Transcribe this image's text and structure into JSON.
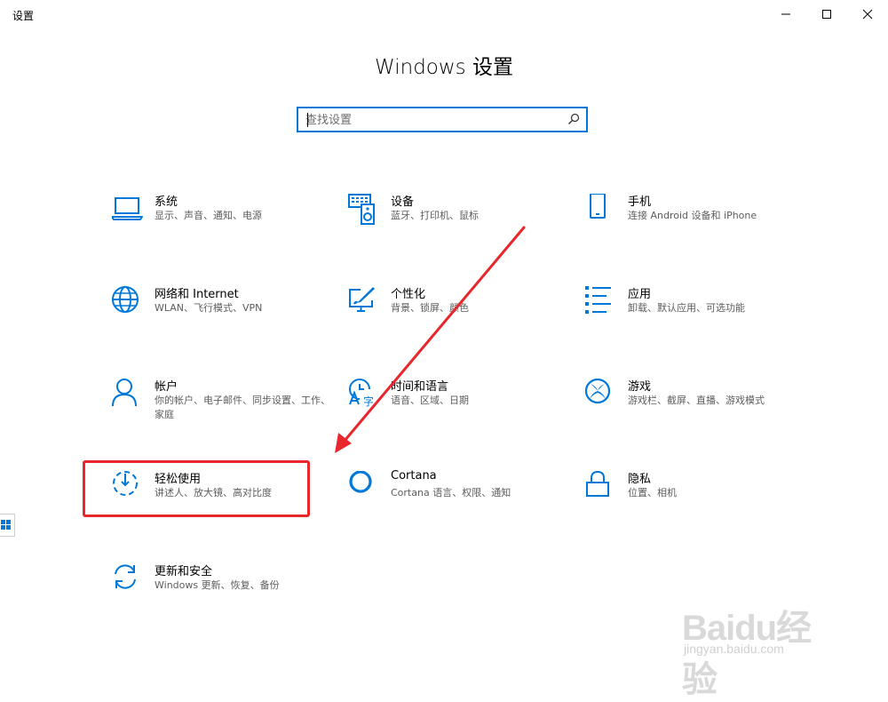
{
  "window": {
    "title": "设置"
  },
  "header": {
    "title": "Windows 设置"
  },
  "search": {
    "placeholder": "查找设置",
    "value": ""
  },
  "accent_color": "#0078d7",
  "highlight_color": "#e8262b",
  "categories": [
    {
      "id": "system",
      "title": "系统",
      "desc": "显示、声音、通知、电源",
      "icon": "laptop-icon"
    },
    {
      "id": "devices",
      "title": "设备",
      "desc": "蓝牙、打印机、鼠标",
      "icon": "keyboard-speaker-icon"
    },
    {
      "id": "phone",
      "title": "手机",
      "desc": "连接 Android 设备和 iPhone",
      "icon": "phone-icon"
    },
    {
      "id": "network",
      "title": "网络和 Internet",
      "desc": "WLAN、飞行模式、VPN",
      "icon": "globe-icon"
    },
    {
      "id": "personalization",
      "title": "个性化",
      "desc": "背景、锁屏、颜色",
      "icon": "paint-brush-icon"
    },
    {
      "id": "apps",
      "title": "应用",
      "desc": "卸载、默认应用、可选功能",
      "icon": "app-list-icon"
    },
    {
      "id": "accounts",
      "title": "帐户",
      "desc": "你的帐户、电子邮件、同步设置、工作、家庭",
      "icon": "person-icon"
    },
    {
      "id": "time-language",
      "title": "时间和语言",
      "desc": "语音、区域、日期",
      "icon": "clock-language-icon"
    },
    {
      "id": "gaming",
      "title": "游戏",
      "desc": "游戏栏、截屏、直播、游戏模式",
      "icon": "xbox-icon"
    },
    {
      "id": "ease-of-access",
      "title": "轻松使用",
      "desc": "讲述人、放大镜、高对比度",
      "icon": "ease-of-access-icon"
    },
    {
      "id": "cortana",
      "title": "Cortana",
      "desc": "Cortana 语言、权限、通知",
      "icon": "cortana-ring-icon"
    },
    {
      "id": "privacy",
      "title": "隐私",
      "desc": "位置、相机",
      "icon": "lock-icon"
    },
    {
      "id": "update-security",
      "title": "更新和安全",
      "desc": "Windows 更新、恢复、备份",
      "icon": "refresh-icon"
    }
  ],
  "watermark": {
    "logo": "Baidu经验",
    "url": "jingyan.baidu.com"
  }
}
